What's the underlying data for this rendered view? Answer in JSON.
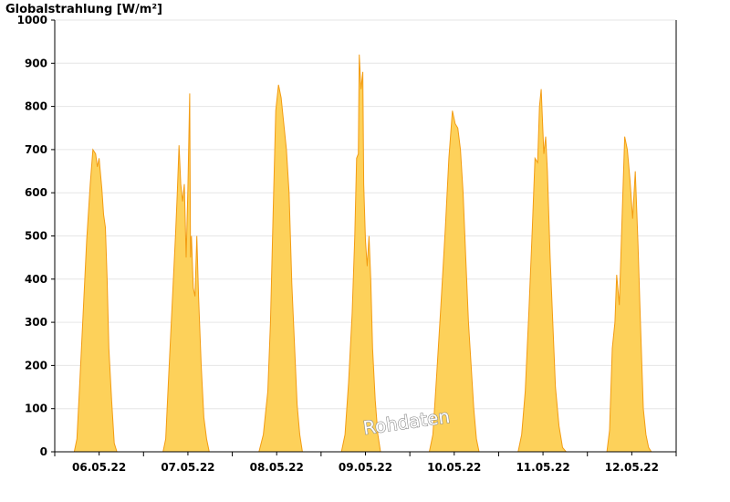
{
  "chart_data": {
    "type": "area",
    "title": "Globalstrahlung [W/m²]",
    "ylim": [
      0,
      1000
    ],
    "y_ticks": [
      0,
      100,
      200,
      300,
      400,
      500,
      600,
      700,
      800,
      900,
      1000
    ],
    "x_ticks": [
      "06.05.22",
      "07.05.22",
      "08.05.22",
      "09.05.22",
      "10.05.22",
      "11.05.22",
      "12.05.22"
    ],
    "xlim_days": [
      0,
      7
    ],
    "grid": true,
    "fill_color": "#fdd15a",
    "line_color": "#f39c12",
    "watermark": "Rohdaten",
    "series": [
      {
        "x": [
          0.22,
          0.25,
          0.28,
          0.32,
          0.36,
          0.4,
          0.43,
          0.46,
          0.48,
          0.5,
          0.53,
          0.55,
          0.57,
          0.59,
          0.61,
          0.64,
          0.67,
          0.7,
          0.73,
          0.76,
          0.78,
          0.8,
          1.22,
          1.25,
          1.28,
          1.32,
          1.36,
          1.38,
          1.4,
          1.42,
          1.44,
          1.46,
          1.48,
          1.5,
          1.52,
          1.53,
          1.54,
          1.56,
          1.58,
          1.6,
          1.62,
          1.65,
          1.68,
          1.71,
          1.74,
          1.77,
          1.79,
          1.81,
          2.22,
          2.26,
          2.3,
          2.35,
          2.38,
          2.4,
          2.43,
          2.46,
          2.49,
          2.52,
          2.55,
          2.58,
          2.61,
          2.64,
          2.67,
          2.7,
          2.73,
          2.76,
          2.79,
          2.81,
          3.23,
          3.27,
          3.31,
          3.35,
          3.38,
          3.4,
          3.42,
          3.43,
          3.45,
          3.47,
          3.48,
          3.5,
          3.52,
          3.54,
          3.56,
          3.58,
          3.61,
          3.64,
          3.67,
          3.7,
          3.73,
          3.77,
          3.8,
          4.22,
          4.26,
          4.3,
          4.35,
          4.4,
          4.44,
          4.48,
          4.51,
          4.54,
          4.57,
          4.6,
          4.63,
          4.66,
          4.69,
          4.72,
          4.75,
          4.78,
          4.81,
          5.22,
          5.26,
          5.3,
          5.34,
          5.38,
          5.41,
          5.44,
          5.46,
          5.48,
          5.51,
          5.53,
          5.55,
          5.58,
          5.61,
          5.64,
          5.68,
          5.72,
          5.76,
          5.79,
          5.81,
          6.22,
          6.25,
          6.28,
          6.31,
          6.33,
          6.36,
          6.39,
          6.42,
          6.45,
          6.48,
          6.51,
          6.54,
          6.57,
          6.59,
          6.61,
          6.63,
          6.66,
          6.69,
          6.72,
          6.75,
          6.78,
          6.81
        ],
        "values": [
          0,
          30,
          150,
          320,
          490,
          620,
          700,
          690,
          660,
          680,
          610,
          550,
          520,
          400,
          240,
          120,
          20,
          0,
          0,
          0,
          0,
          0,
          0,
          30,
          160,
          330,
          500,
          600,
          710,
          620,
          580,
          620,
          450,
          610,
          830,
          450,
          500,
          380,
          360,
          500,
          360,
          200,
          80,
          30,
          0,
          0,
          0,
          0,
          0,
          0,
          0,
          40,
          100,
          140,
          300,
          550,
          790,
          850,
          820,
          760,
          700,
          600,
          390,
          250,
          110,
          40,
          0,
          0,
          0,
          40,
          160,
          320,
          500,
          680,
          690,
          920,
          840,
          880,
          620,
          490,
          430,
          500,
          400,
          240,
          120,
          40,
          0,
          0,
          0,
          0,
          0,
          0,
          40,
          170,
          340,
          520,
          680,
          790,
          760,
          750,
          700,
          600,
          450,
          300,
          200,
          100,
          30,
          0,
          0,
          0,
          40,
          140,
          320,
          520,
          680,
          670,
          800,
          840,
          690,
          730,
          650,
          450,
          300,
          150,
          60,
          10,
          0,
          0,
          0,
          0,
          50,
          240,
          300,
          410,
          340,
          540,
          730,
          700,
          630,
          540,
          650,
          480,
          350,
          220,
          100,
          40,
          10,
          0,
          0,
          0,
          0
        ]
      }
    ]
  }
}
